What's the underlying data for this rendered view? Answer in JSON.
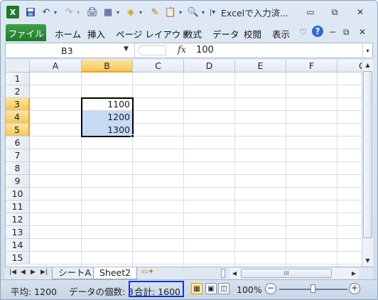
{
  "window": {
    "title": "Excelで入力済...",
    "minimize_icon": "minimize-icon",
    "restore_icon": "restore-icon",
    "close_icon": "close-icon"
  },
  "quick_access": {
    "excel_icon": "excel-logo-icon",
    "save_icon": "save-icon",
    "undo_icon": "undo-icon",
    "redo_icon": "redo-icon"
  },
  "ribbon": {
    "file_tab": "ファイル",
    "tabs": [
      "ホーム",
      "挿入",
      "ページ レイアウト",
      "数式",
      "データ",
      "校閲",
      "表示"
    ]
  },
  "formula_bar": {
    "name_box": "B3",
    "fx_label": "fx",
    "value": "100"
  },
  "sheet": {
    "columns": [
      "A",
      "B",
      "C",
      "D",
      "E",
      "F",
      "G"
    ],
    "selected_column": "B",
    "rows": [
      "1",
      "2",
      "3",
      "4",
      "5",
      "6",
      "7",
      "8",
      "9",
      "10",
      "11",
      "12",
      "13",
      "14",
      "15"
    ],
    "selected_rows": [
      "3",
      "4",
      "5"
    ],
    "cells": {
      "B3": "1100",
      "B4": "1200",
      "B5": "1300"
    }
  },
  "sheet_tabs": {
    "tabs": [
      "シートA",
      "Sheet2"
    ],
    "active": "Sheet2"
  },
  "status_bar": {
    "average": "平均: 1200",
    "count": "データの個数: 3",
    "sum": "合計: 1600",
    "zoom": "100%",
    "sum_box_color": "#1234d8"
  },
  "colors": {
    "file_tab": "#2a8a36",
    "selected_header": "#f6c657",
    "selected_cell": "#c5dbf4"
  }
}
